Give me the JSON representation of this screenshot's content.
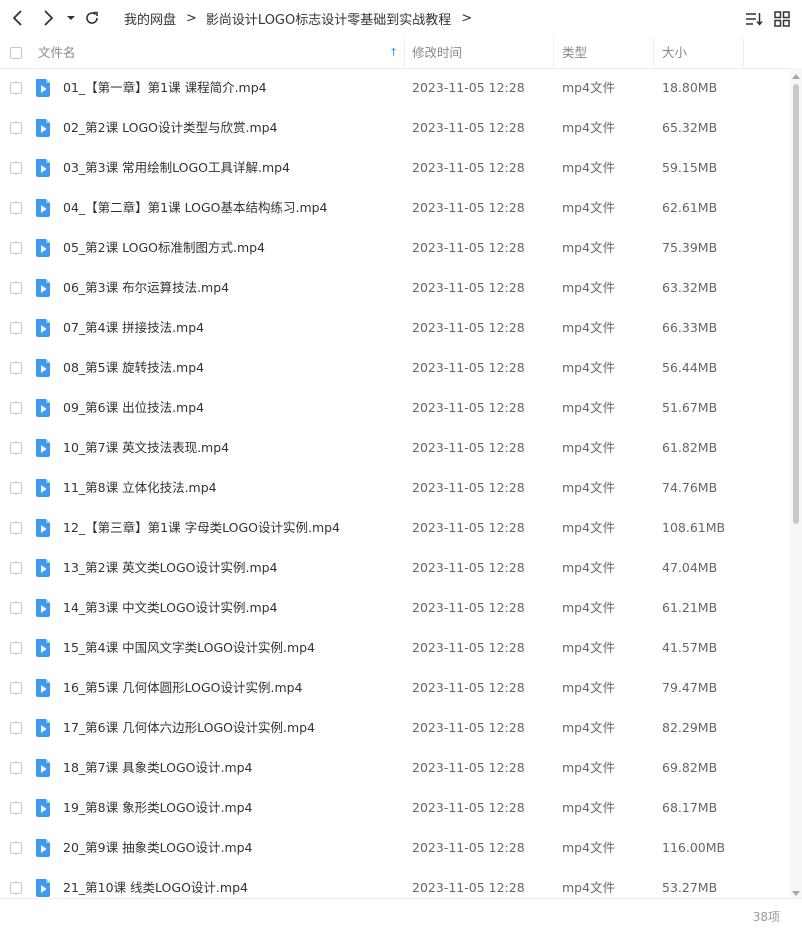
{
  "toolbar": {
    "icons": [
      "back-icon",
      "forward-icon",
      "chevron-down-icon",
      "refresh-icon",
      "sort-icon",
      "grid-view-icon"
    ]
  },
  "breadcrumb": {
    "items": [
      "我的网盘",
      "影尚设计LOGO标志设计零基础到实战教程"
    ],
    "separator": ">"
  },
  "header": {
    "name": "文件名",
    "time": "修改时间",
    "type": "类型",
    "size": "大小",
    "sort_indicator": "↑"
  },
  "accent_color": "#3b9bf2",
  "files": [
    {
      "name": "01_【第一章】第1课 课程简介.mp4",
      "time": "2023-11-05 12:28",
      "type": "mp4文件",
      "size": "18.80MB"
    },
    {
      "name": "02_第2课 LOGO设计类型与欣赏.mp4",
      "time": "2023-11-05 12:28",
      "type": "mp4文件",
      "size": "65.32MB"
    },
    {
      "name": "03_第3课 常用绘制LOGO工具详解.mp4",
      "time": "2023-11-05 12:28",
      "type": "mp4文件",
      "size": "59.15MB"
    },
    {
      "name": "04_【第二章】第1课 LOGO基本结构练习.mp4",
      "time": "2023-11-05 12:28",
      "type": "mp4文件",
      "size": "62.61MB"
    },
    {
      "name": "05_第2课 LOGO标准制图方式.mp4",
      "time": "2023-11-05 12:28",
      "type": "mp4文件",
      "size": "75.39MB"
    },
    {
      "name": "06_第3课 布尔运算技法.mp4",
      "time": "2023-11-05 12:28",
      "type": "mp4文件",
      "size": "63.32MB"
    },
    {
      "name": "07_第4课 拼接技法.mp4",
      "time": "2023-11-05 12:28",
      "type": "mp4文件",
      "size": "66.33MB"
    },
    {
      "name": "08_第5课 旋转技法.mp4",
      "time": "2023-11-05 12:28",
      "type": "mp4文件",
      "size": "56.44MB"
    },
    {
      "name": "09_第6课 出位技法.mp4",
      "time": "2023-11-05 12:28",
      "type": "mp4文件",
      "size": "51.67MB"
    },
    {
      "name": "10_第7课 英文技法表现.mp4",
      "time": "2023-11-05 12:28",
      "type": "mp4文件",
      "size": "61.82MB"
    },
    {
      "name": "11_第8课 立体化技法.mp4",
      "time": "2023-11-05 12:28",
      "type": "mp4文件",
      "size": "74.76MB"
    },
    {
      "name": "12_【第三章】第1课 字母类LOGO设计实例.mp4",
      "time": "2023-11-05 12:28",
      "type": "mp4文件",
      "size": "108.61MB"
    },
    {
      "name": "13_第2课 英文类LOGO设计实例.mp4",
      "time": "2023-11-05 12:28",
      "type": "mp4文件",
      "size": "47.04MB"
    },
    {
      "name": "14_第3课 中文类LOGO设计实例.mp4",
      "time": "2023-11-05 12:28",
      "type": "mp4文件",
      "size": "61.21MB"
    },
    {
      "name": "15_第4课 中国风文字类LOGO设计实例.mp4",
      "time": "2023-11-05 12:28",
      "type": "mp4文件",
      "size": "41.57MB"
    },
    {
      "name": "16_第5课 几何体圆形LOGO设计实例.mp4",
      "time": "2023-11-05 12:28",
      "type": "mp4文件",
      "size": "79.47MB"
    },
    {
      "name": "17_第6课 几何体六边形LOGO设计实例.mp4",
      "time": "2023-11-05 12:28",
      "type": "mp4文件",
      "size": "82.29MB"
    },
    {
      "name": "18_第7课 具象类LOGO设计.mp4",
      "time": "2023-11-05 12:28",
      "type": "mp4文件",
      "size": "69.82MB"
    },
    {
      "name": "19_第8课 象形类LOGO设计.mp4",
      "time": "2023-11-05 12:28",
      "type": "mp4文件",
      "size": "68.17MB"
    },
    {
      "name": "20_第9课 抽象类LOGO设计.mp4",
      "time": "2023-11-05 12:28",
      "type": "mp4文件",
      "size": "116.00MB"
    },
    {
      "name": "21_第10课 线类LOGO设计.mp4",
      "time": "2023-11-05 12:28",
      "type": "mp4文件",
      "size": "53.27MB"
    }
  ],
  "footer": {
    "count": "38项"
  }
}
